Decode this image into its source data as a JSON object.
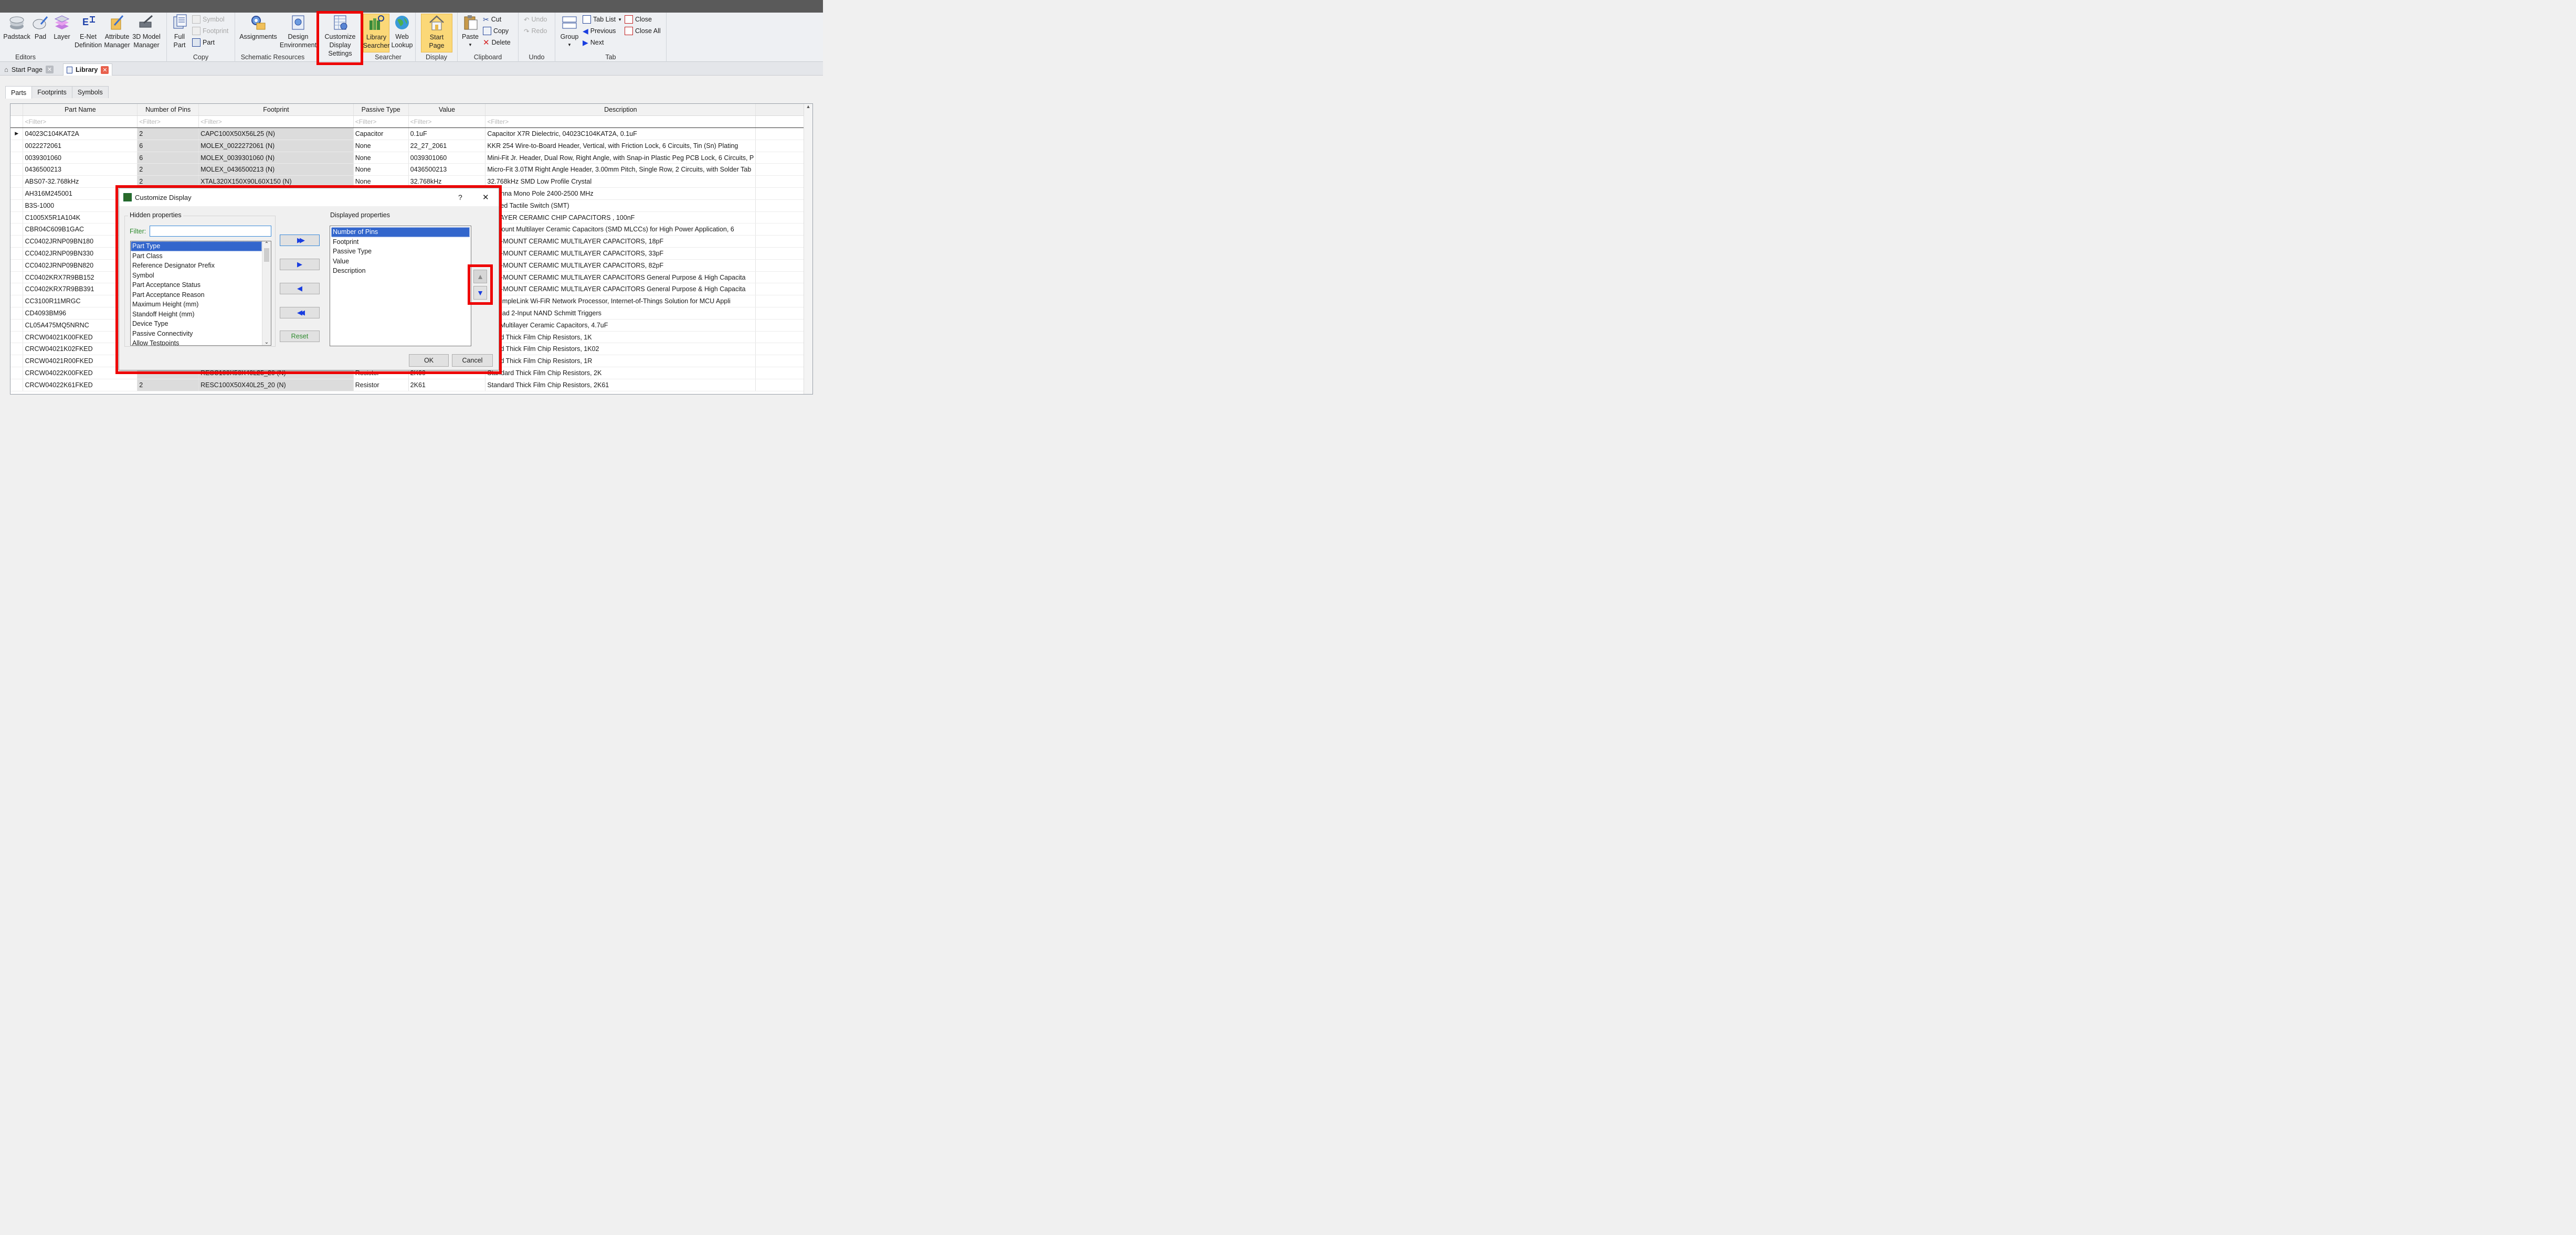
{
  "ribbon": {
    "editors": {
      "group_label": "Editors",
      "padstack": "Padstack",
      "pad": "Pad",
      "layer": "Layer",
      "enet_l1": "E-Net",
      "enet_l2": "Definition",
      "attr_l1": "Attribute",
      "attr_l2": "Manager",
      "model_l1": "3D Model",
      "model_l2": "Manager"
    },
    "copy": {
      "group_label": "Copy",
      "full_l1": "Full",
      "full_l2": "Part",
      "symbol": "Symbol",
      "footprint": "Footprint",
      "part": "Part"
    },
    "schematic": {
      "group_label": "Schematic Resources",
      "assignments": "Assignments",
      "design_l1": "Design",
      "design_l2": "Environment"
    },
    "customize": {
      "l1": "Customize",
      "l2": "Display",
      "l3": "Settings"
    },
    "searcher": {
      "group_label": "Searcher",
      "lib_l1": "Library",
      "lib_l2": "Searcher",
      "web_l1": "Web",
      "web_l2": "Lookup"
    },
    "display": {
      "group_label": "Display",
      "start_page": "Start Page"
    },
    "clipboard": {
      "group_label": "Clipboard",
      "paste": "Paste",
      "cut": "Cut",
      "copy": "Copy",
      "delete": "Delete"
    },
    "undo": {
      "group_label": "Undo",
      "undo": "Undo",
      "redo": "Redo"
    },
    "tab": {
      "group_label": "Tab",
      "group": "Group",
      "tab_list": "Tab List",
      "previous": "Previous",
      "next": "Next",
      "close": "Close",
      "close_all": "Close All"
    }
  },
  "doc_tabs": [
    {
      "label": "Start Page"
    },
    {
      "label": "Library"
    }
  ],
  "inner_tabs": [
    "Parts",
    "Footprints",
    "Symbols"
  ],
  "grid": {
    "columns": [
      "Part Name",
      "Number of Pins",
      "Footprint",
      "Passive Type",
      "Value",
      "Description"
    ],
    "filter_placeholder": "<Filter>",
    "rows": [
      [
        "04023C104KAT2A",
        "2",
        "CAPC100X50X56L25 (N)",
        "Capacitor",
        "0.1uF",
        "Capacitor X7R Dielectric, 04023C104KAT2A, 0.1uF"
      ],
      [
        "0022272061",
        "6",
        "MOLEX_0022272061 (N)",
        "None",
        "22_27_2061",
        "KKR 254 Wire-to-Board Header, Vertical, with Friction Lock, 6 Circuits, Tin (Sn) Plating"
      ],
      [
        "0039301060",
        "6",
        "MOLEX_0039301060 (N)",
        "None",
        "0039301060",
        "Mini-Fit Jr. Header, Dual Row, Right Angle, with Snap-in Plastic Peg PCB Lock, 6 Circuits, P"
      ],
      [
        "0436500213",
        "2",
        "MOLEX_0436500213 (N)",
        "None",
        "0436500213",
        "Micro-Fit 3.0TM Right Angle Header, 3.00mm Pitch, Single Row, 2 Circuits, with Solder Tab"
      ],
      [
        "ABS07-32.768kHz",
        "2",
        "XTAL320X150X90L60X150 (N)",
        "None",
        "32.768kHz",
        "32.768kHz SMD Low Profile Crystal"
      ],
      [
        "AH316M245001",
        "",
        "",
        "",
        "",
        "Antenna Mono Pole 2400-2500 MHz"
      ],
      [
        "B3S-1000",
        "",
        "",
        "",
        "",
        "Sealed Tactile Switch (SMT)"
      ],
      [
        "C1005X5R1A104K",
        "",
        "",
        "",
        "",
        "LTILAYER CERAMIC CHIP CAPACITORS , 100nF"
      ],
      [
        "CBR04C609B1GAC",
        "",
        "",
        "",
        "",
        "ce Mount Multilayer Ceramic Capacitors (SMD MLCCs) for High Power Application, 6"
      ],
      [
        "CC0402JRNP09BN180",
        "",
        "",
        "",
        "",
        "ACE-MOUNT CERAMIC MULTILAYER CAPACITORS, 18pF"
      ],
      [
        "CC0402JRNP09BN330",
        "",
        "",
        "",
        "",
        "ACE-MOUNT CERAMIC MULTILAYER CAPACITORS, 33pF"
      ],
      [
        "CC0402JRNP09BN820",
        "",
        "",
        "",
        "",
        "ACE-MOUNT CERAMIC MULTILAYER CAPACITORS, 82pF"
      ],
      [
        "CC0402KRX7R9BB152",
        "",
        "",
        "",
        "",
        "ACE-MOUNT CERAMIC MULTILAYER CAPACITORS General Purpose & High Capacita"
      ],
      [
        "CC0402KRX7R9BB391",
        "",
        "",
        "",
        "",
        "ACE-MOUNT CERAMIC MULTILAYER CAPACITORS General Purpose & High Capacita"
      ],
      [
        "CC3100R11MRGC",
        "",
        "",
        "",
        "",
        "00 SimpleLink Wi-FiR Network Processor, Internet-of-Things Solution for MCU Appli"
      ],
      [
        "CD4093BM96",
        "",
        "",
        "",
        "",
        "S Quad 2-Input NAND Schmitt Triggers"
      ],
      [
        "CL05A475MQ5NRNC",
        "",
        "",
        "",
        "",
        "eral Multilayer Ceramic Capacitors, 4.7uF"
      ],
      [
        "CRCW04021K00FKED",
        "",
        "",
        "",
        "",
        "ndard Thick Film Chip Resistors, 1K"
      ],
      [
        "CRCW04021K02FKED",
        "",
        "",
        "",
        "",
        "ndard Thick Film Chip Resistors, 1K02"
      ],
      [
        "CRCW04021R00FKED",
        "",
        "",
        "",
        "",
        "ndard Thick Film Chip Resistors, 1R"
      ],
      [
        "CRCW04022K00FKED",
        "",
        "RESC100X50X40L25_20 (N)",
        "Resistor",
        "2K00",
        "Standard Thick Film Chip Resistors, 2K"
      ],
      [
        "CRCW04022K61FKED",
        "2",
        "RESC100X50X40L25_20 (N)",
        "Resistor",
        "2K61",
        "Standard Thick Film Chip Resistors, 2K61"
      ]
    ]
  },
  "dialog": {
    "title": "Customize Display",
    "help": "?",
    "close": "✕",
    "hidden_label": "Hidden properties",
    "filter_label": "Filter:",
    "filter_value": "",
    "hidden_items": [
      "Part Type",
      "Part Class",
      "Reference Designator Prefix",
      "Symbol",
      "Part Acceptance Status",
      "Part Acceptance Reason",
      "Maximum Height (mm)",
      "Standoff Height (mm)",
      "Device Type",
      "Passive Connectivity",
      "Allow Testpoints"
    ],
    "displayed_label": "Displayed properties",
    "displayed_items": [
      "Number of Pins",
      "Footprint",
      "Passive Type",
      "Value",
      "Description"
    ],
    "reset": "Reset",
    "ok": "OK",
    "cancel": "Cancel"
  },
  "colors": {
    "highlight": "#ee0000",
    "selection": "#3366cc",
    "active_button": "#fbd878",
    "close_tab": "#e8604c"
  }
}
